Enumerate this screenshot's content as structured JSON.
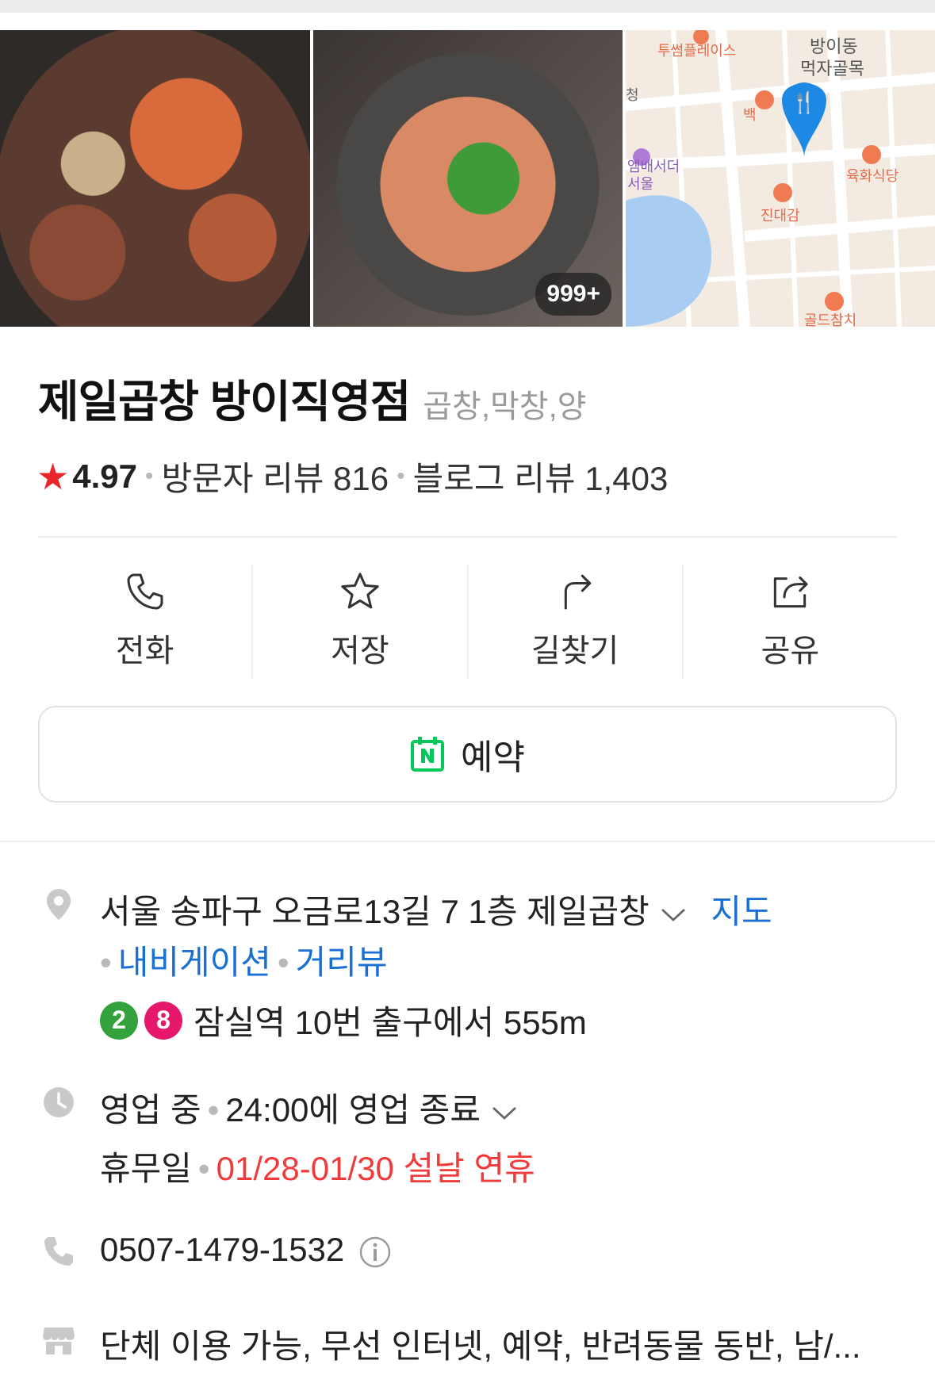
{
  "gallery": {
    "photo_count_badge": "999+"
  },
  "map_thumb": {
    "labels": [
      "투썸플레이스",
      "방이동",
      "먹자골목",
      "청",
      "백",
      "육화식당",
      "엠배서더",
      "서울",
      "진대감",
      "골드참치"
    ]
  },
  "place": {
    "name": "제일곱창 방이직영점",
    "category": "곱창,막창,양",
    "rating": "4.97",
    "visitor_reviews_label": "방문자 리뷰 816",
    "blog_reviews_label": "블로그 리뷰 1,403"
  },
  "actions": [
    {
      "label": "전화",
      "icon": "phone-icon"
    },
    {
      "label": "저장",
      "icon": "star-icon"
    },
    {
      "label": "길찾기",
      "icon": "directions-icon"
    },
    {
      "label": "공유",
      "icon": "share-icon"
    }
  ],
  "reserve": {
    "label": "예약",
    "icon": "naver-calendar-icon",
    "brand_color": "#03c75a"
  },
  "address": {
    "text": "서울 송파구 오금로13길 7 1층 제일곱창",
    "map_link": "지도",
    "navigation_link": "내비게이션",
    "streetview_link": "거리뷰"
  },
  "subway": {
    "lines": [
      {
        "number": "2",
        "color": "#33a23d"
      },
      {
        "number": "8",
        "color": "#e6186c"
      }
    ],
    "text": "잠실역 10번 출구에서 555m"
  },
  "hours": {
    "status": "영업 중",
    "close_text": "24:00에 영업 종료",
    "holiday_label": "휴무일",
    "holiday_text": "01/28-01/30 설날 연휴"
  },
  "phone": {
    "number": "0507-1479-1532"
  },
  "amenities": {
    "text": "단체 이용 가능, 무선 인터넷, 예약, 반려동물 동반, 남/..."
  },
  "colors": {
    "accent_blue": "#1a6fd4",
    "star_red": "#e8262c",
    "holiday_red": "#ef3b3b",
    "map_pin_blue": "#1e88e5"
  }
}
